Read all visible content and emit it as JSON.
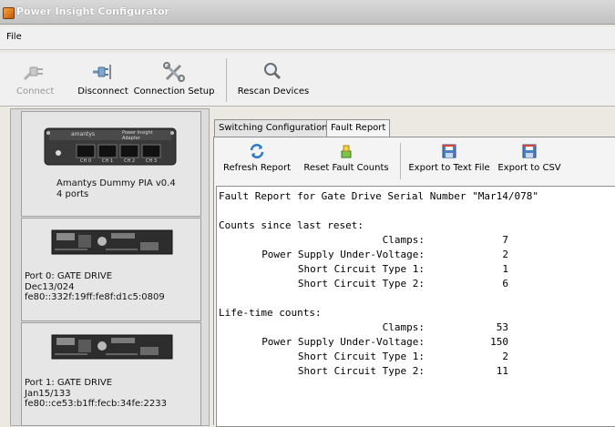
{
  "window": {
    "title": "Power Insight Configurator"
  },
  "menu": {
    "items": [
      "File"
    ]
  },
  "toolbar": {
    "connect": "Connect",
    "disconnect": "Disconnect",
    "connection_setup": "Connection Setup",
    "rescan": "Rescan Devices"
  },
  "devices": [
    {
      "name": "Amantys Dummy PIA  v0.4",
      "detail": "4 ports",
      "brand": "amantys",
      "board_caption": "Power Insight Adapter",
      "channels": [
        "CH 0",
        "CH 1",
        "CH 2",
        "CH 3"
      ]
    },
    {
      "line1": "Port 0: GATE DRIVE",
      "line2": "Dec13/024",
      "line3": "fe80::332f:19ff:fe8f:d1c5:0809"
    },
    {
      "line1": "Port 1: GATE DRIVE",
      "line2": "Jan15/133",
      "line3": "fe80::ce53:b1ff:fecb:34fe:2233"
    }
  ],
  "tabs": [
    "Switching Configuration",
    "Fault Report"
  ],
  "active_tab": "Fault Report",
  "report_toolbar": {
    "refresh": "Refresh Report",
    "reset": "Reset Fault Counts",
    "export_text": "Export to Text File",
    "export_csv": "Export to CSV"
  },
  "report": {
    "header": "Fault Report for Gate Drive Serial Number \"Mar14/078\"",
    "sections": [
      {
        "title": "Counts since last reset:",
        "rows": [
          {
            "label": "Clamps:",
            "value": "7"
          },
          {
            "label": "Power Supply Under-Voltage:",
            "value": "2"
          },
          {
            "label": "Short Circuit Type 1:",
            "value": "1"
          },
          {
            "label": "Short Circuit Type 2:",
            "value": "6"
          }
        ]
      },
      {
        "title": "Life-time counts:",
        "rows": [
          {
            "label": "Clamps:",
            "value": "53"
          },
          {
            "label": "Power Supply Under-Voltage:",
            "value": "150"
          },
          {
            "label": "Short Circuit Type 1:",
            "value": "2"
          },
          {
            "label": "Short Circuit Type 2:",
            "value": "11"
          }
        ]
      }
    ]
  },
  "colors": {
    "accent": "#f8a33a",
    "sidebar_bg": "#dcdcdc",
    "panel_bg": "#f4f4f4"
  }
}
